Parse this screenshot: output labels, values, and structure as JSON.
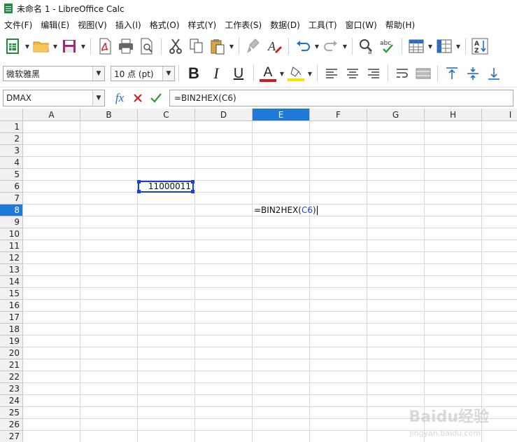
{
  "window": {
    "title": "未命名 1 - LibreOffice Calc"
  },
  "menu": [
    "文件(F)",
    "编辑(E)",
    "视图(V)",
    "插入(I)",
    "格式(O)",
    "样式(Y)",
    "工作表(S)",
    "数据(D)",
    "工具(T)",
    "窗口(W)",
    "帮助(H)"
  ],
  "toolbar2": {
    "font_name": "微软雅黑",
    "font_size": "10 点 (pt)",
    "bold": "B",
    "italic": "I",
    "underline": "U",
    "font_color_letter": "A"
  },
  "formula_bar": {
    "name_box": "DMAX",
    "fx_label": "fx",
    "content": "=BIN2HEX(C6)"
  },
  "sheet": {
    "columns": [
      "A",
      "B",
      "C",
      "D",
      "E",
      "F",
      "G",
      "H",
      "I"
    ],
    "rows": [
      "1",
      "2",
      "3",
      "4",
      "5",
      "6",
      "7",
      "8",
      "9",
      "10",
      "11",
      "12",
      "13",
      "14",
      "15",
      "16",
      "17",
      "18",
      "19",
      "20",
      "21",
      "22",
      "23",
      "24",
      "25",
      "26",
      "27"
    ],
    "active_column": "E",
    "active_row": "8",
    "cell_c6": "11000011",
    "cell_e8_prefix": "=BIN2HEX(",
    "cell_e8_ref": "C6",
    "cell_e8_suffix": ")"
  },
  "watermark": {
    "text": "Baidu经验",
    "sub": "jingyan.baidu.com"
  },
  "colors": {
    "accent": "#1e7ad6",
    "ref_border": "#1c3fd6",
    "font_color_bar": "#d6191b",
    "highlight_bar": "#f2e600"
  }
}
